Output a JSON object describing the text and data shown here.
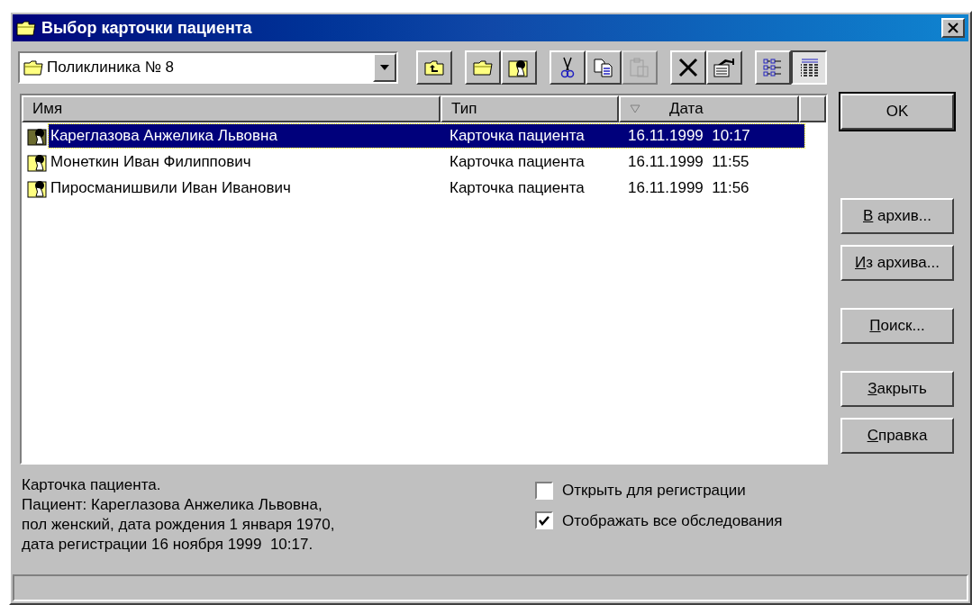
{
  "window": {
    "title": "Выбор карточки пациента"
  },
  "location": {
    "value": "Поликлиника № 8"
  },
  "toolbar": [
    {
      "kind": "up-folder",
      "disabled": false,
      "selected": false
    },
    {
      "kind": "new-folder",
      "disabled": false,
      "selected": false
    },
    {
      "kind": "new-card",
      "disabled": false,
      "selected": false
    },
    {
      "kind": "cut",
      "disabled": false,
      "selected": false
    },
    {
      "kind": "copy",
      "disabled": false,
      "selected": false
    },
    {
      "kind": "paste",
      "disabled": true,
      "selected": false
    },
    {
      "kind": "delete",
      "disabled": false,
      "selected": false
    },
    {
      "kind": "properties",
      "disabled": false,
      "selected": false
    },
    {
      "kind": "list-view",
      "disabled": false,
      "selected": false
    },
    {
      "kind": "details-view",
      "disabled": false,
      "selected": true
    }
  ],
  "table": {
    "columns": [
      {
        "label": "Имя",
        "sorted": false
      },
      {
        "label": "Тип",
        "sorted": false
      },
      {
        "label": "Дата",
        "sorted": true
      }
    ],
    "rows": [
      {
        "name": "Кареглазова Анжелика Львовна",
        "type": "Карточка пациента",
        "date": "16.11.1999  10:17",
        "selected": true
      },
      {
        "name": "Монеткин Иван Филиппович",
        "type": "Карточка пациента",
        "date": "16.11.1999  11:55",
        "selected": false
      },
      {
        "name": "Пиросманишвили Иван Иванович",
        "type": "Карточка пациента",
        "date": "16.11.1999  11:56",
        "selected": false
      }
    ]
  },
  "buttons": [
    {
      "label": "OK",
      "underline_first": false,
      "default": true
    },
    {
      "label": "В архив...",
      "underline_first": true,
      "default": false
    },
    {
      "label": "Из архива...",
      "underline_first": true,
      "default": false
    },
    {
      "label": "Поиск...",
      "underline_first": true,
      "default": false
    },
    {
      "label": "Закрыть",
      "underline_first": true,
      "default": false
    },
    {
      "label": "Справка",
      "underline_first": true,
      "default": false
    }
  ],
  "description": [
    "Карточка пациента.",
    "Пациент: Кареглазова Анжелика Львовна,",
    "пол женский, дата рождения 1 января 1970,",
    "дата регистрации 16 ноября 1999  10:17."
  ],
  "options": [
    {
      "label": "Открыть для регистрации",
      "checked": false
    },
    {
      "label": "Отображать все обследования",
      "checked": true
    }
  ]
}
